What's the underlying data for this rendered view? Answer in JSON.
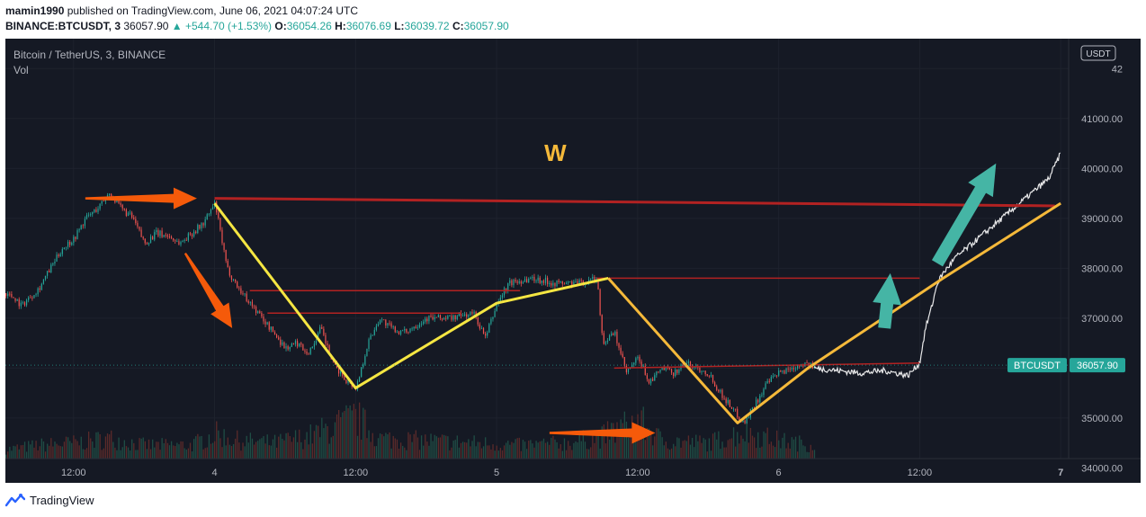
{
  "header": {
    "author": "mamin1990",
    "published_text": "published on TradingView.com, June 06, 2021 04:07:24 UTC",
    "symbol": "BINANCE:BTCUSDT, 3",
    "price": "36057.90",
    "change": "▲ +544.70 (+1.53%)",
    "o_label": "O:",
    "o_value": "36054.26",
    "h_label": "H:",
    "h_value": "36076.69",
    "l_label": "L:",
    "l_value": "36039.72",
    "c_label": "C:",
    "c_value": "36057.90"
  },
  "legend": {
    "title": "Bitcoin / TetherUS, 3, BINANCE",
    "indicator": "Vol"
  },
  "footer": {
    "brand": "TradingView"
  },
  "colors": {
    "background": "#151924",
    "up_candle": "#26a69a",
    "down_candle": "#ef5350",
    "w_pattern": "#f5e642",
    "w_pattern_right": "#f5b93a",
    "resistance": "#b22222",
    "arrow_orange": "#f55a0a",
    "arrow_teal": "#45b5a5",
    "projection": "#ffffff",
    "price_label": "#26a69a"
  },
  "chart_data": {
    "type": "candlestick",
    "symbol": "BTCUSDT",
    "timeframe": "3",
    "exchange": "BINANCE",
    "current_price": 36057.9,
    "price_label": "BTCUSDT",
    "currency_badge": "USDT",
    "y_ticks": [
      42000,
      41000,
      40000,
      39000,
      38000,
      37000,
      36000,
      35000,
      34000
    ],
    "y_tick_labels": [
      "42",
      "41000.00",
      "40000.00",
      "39000.00",
      "38000.00",
      "37000.00",
      "36000.00",
      "35000.00",
      "34000.00"
    ],
    "x_ticks": [
      {
        "label": "12:00",
        "t": 0
      },
      {
        "label": "4",
        "t": 12
      },
      {
        "label": "12:00",
        "t": 24
      },
      {
        "label": "5",
        "t": 36
      },
      {
        "label": "12:00",
        "t": 48
      },
      {
        "label": "6",
        "t": 60
      },
      {
        "label": "12:00",
        "t": 72
      },
      {
        "label": "7",
        "t": 84
      }
    ],
    "x_range": [
      -5.8,
      90.8
    ],
    "y_range": [
      33700,
      42600
    ],
    "price_path": [
      [
        -5.8,
        37500
      ],
      [
        -5,
        37400
      ],
      [
        -4.5,
        37250
      ],
      [
        -3,
        37600
      ],
      [
        -2,
        38000
      ],
      [
        -1,
        38400
      ],
      [
        0,
        38600
      ],
      [
        1,
        39000
      ],
      [
        2,
        39200
      ],
      [
        3,
        39500
      ],
      [
        4,
        39200
      ],
      [
        5,
        39000
      ],
      [
        6,
        38500
      ],
      [
        7,
        38700
      ],
      [
        8,
        38650
      ],
      [
        9,
        38500
      ],
      [
        10,
        38700
      ],
      [
        11,
        38900
      ],
      [
        12,
        39300
      ],
      [
        13,
        38000
      ],
      [
        14,
        37600
      ],
      [
        15,
        37300
      ],
      [
        16,
        37000
      ],
      [
        17,
        36700
      ],
      [
        18,
        36400
      ],
      [
        19,
        36500
      ],
      [
        20,
        36300
      ],
      [
        21,
        36800
      ],
      [
        22,
        36100
      ],
      [
        23,
        35800
      ],
      [
        24,
        35600
      ],
      [
        25,
        36500
      ],
      [
        26,
        37000
      ],
      [
        27,
        36800
      ],
      [
        28,
        36700
      ],
      [
        30,
        37000
      ],
      [
        32,
        37000
      ],
      [
        34,
        37100
      ],
      [
        35,
        36600
      ],
      [
        36,
        37300
      ],
      [
        37,
        37700
      ],
      [
        39,
        37800
      ],
      [
        41,
        37700
      ],
      [
        43,
        37700
      ],
      [
        44.5,
        37800
      ],
      [
        45,
        36500
      ],
      [
        46,
        36700
      ],
      [
        47,
        35900
      ],
      [
        48,
        36200
      ],
      [
        49,
        35700
      ],
      [
        50,
        36000
      ],
      [
        51,
        35900
      ],
      [
        52,
        36100
      ],
      [
        53,
        36000
      ],
      [
        54,
        35900
      ],
      [
        55,
        35500
      ],
      [
        56,
        35200
      ],
      [
        57,
        34900
      ],
      [
        58,
        35300
      ],
      [
        59,
        35700
      ],
      [
        60,
        35900
      ],
      [
        61,
        36000
      ],
      [
        62,
        36100
      ],
      [
        63,
        36000
      ]
    ],
    "volume_profile": [
      [
        -5.8,
        0.2
      ],
      [
        -3,
        0.3
      ],
      [
        0,
        0.35
      ],
      [
        3,
        0.45
      ],
      [
        6,
        0.3
      ],
      [
        10,
        0.3
      ],
      [
        12,
        0.55
      ],
      [
        14,
        0.4
      ],
      [
        17,
        0.35
      ],
      [
        20,
        0.5
      ],
      [
        24,
        0.9
      ],
      [
        26,
        0.45
      ],
      [
        30,
        0.4
      ],
      [
        34,
        0.35
      ],
      [
        38,
        0.3
      ],
      [
        42,
        0.35
      ],
      [
        45,
        0.5
      ],
      [
        48,
        0.85
      ],
      [
        50,
        0.4
      ],
      [
        54,
        0.35
      ],
      [
        57,
        0.6
      ],
      [
        60,
        0.4
      ],
      [
        63,
        0.3
      ]
    ],
    "projection_path": [
      [
        63,
        36000
      ],
      [
        65,
        35950
      ],
      [
        67,
        35900
      ],
      [
        69,
        35950
      ],
      [
        71,
        35850
      ],
      [
        72,
        36100
      ],
      [
        72.5,
        36800
      ],
      [
        73,
        37200
      ],
      [
        73.5,
        37700
      ],
      [
        74,
        37900
      ],
      [
        75,
        38200
      ],
      [
        77,
        38600
      ],
      [
        79,
        39000
      ],
      [
        81,
        39400
      ],
      [
        83,
        39800
      ],
      [
        84,
        40300
      ]
    ],
    "w_pattern_left": [
      [
        12,
        39300
      ],
      [
        24,
        35600
      ],
      [
        36,
        37300
      ],
      [
        45.5,
        37800
      ]
    ],
    "w_pattern_right": [
      [
        45.5,
        37800
      ],
      [
        56.5,
        34900
      ],
      [
        62.5,
        36000
      ],
      [
        74,
        37800
      ],
      [
        84,
        39300
      ]
    ],
    "resistance_lines": [
      {
        "from": [
          12,
          39400
        ],
        "to": [
          83.5,
          39250
        ],
        "width": 3
      },
      {
        "from": [
          15,
          37550
        ],
        "to": [
          38,
          37550
        ],
        "width": 1.5
      },
      {
        "from": [
          16.5,
          37100
        ],
        "to": [
          33,
          37100
        ],
        "width": 1.5
      },
      {
        "from": [
          44.5,
          37800
        ],
        "to": [
          72,
          37800
        ],
        "width": 1.5
      },
      {
        "from": [
          46,
          36000
        ],
        "to": [
          72,
          36100
        ],
        "width": 1.5
      }
    ],
    "arrows": [
      {
        "color": "orange",
        "from": [
          1,
          39400
        ],
        "to": [
          10.5,
          39400
        ]
      },
      {
        "color": "orange",
        "from": [
          9.5,
          38300
        ],
        "to": [
          13.5,
          36800
        ]
      },
      {
        "color": "orange",
        "from": [
          40.5,
          34700
        ],
        "to": [
          49.5,
          34700
        ]
      },
      {
        "color": "teal",
        "from": [
          73.5,
          38100
        ],
        "to": [
          78.5,
          40100
        ]
      },
      {
        "color": "teal",
        "from": [
          69,
          36800
        ],
        "to": [
          69.5,
          37900
        ]
      }
    ],
    "annotation": {
      "text": "W",
      "t": 41,
      "price": 40150
    }
  }
}
